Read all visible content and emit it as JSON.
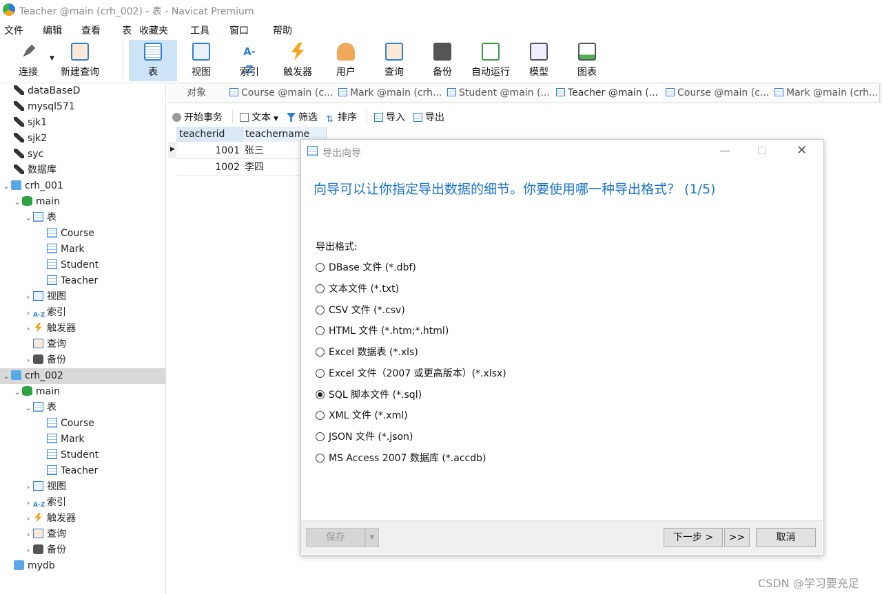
{
  "window": {
    "title": "Teacher @main (crh_002) - 表 - Navicat Premium"
  },
  "menu": [
    "文件",
    "编辑",
    "查看",
    "表",
    "收藏夹",
    "工具",
    "窗口",
    "帮助"
  ],
  "toolbar": {
    "connect": "连接",
    "new_query": "新建查询",
    "items": [
      "表",
      "视图",
      "索引",
      "触发器",
      "用户",
      "查询",
      "备份",
      "自动运行",
      "模型",
      "图表"
    ]
  },
  "tree": {
    "connections_top": [
      "dataBaseD",
      "mysql571",
      "sjk1",
      "sjk2",
      "syc",
      "数据库"
    ],
    "crh_001": {
      "name": "crh_001",
      "db": "main",
      "tables_label": "表",
      "tables": [
        "Course",
        "Mark",
        "Student",
        "Teacher"
      ],
      "others": [
        "视图",
        "索引",
        "触发器",
        "查询",
        "备份"
      ]
    },
    "crh_002": {
      "name": "crh_002",
      "db": "main",
      "tables_label": "表",
      "tables": [
        "Course",
        "Mark",
        "Student",
        "Teacher"
      ],
      "others": [
        "视图",
        "索引",
        "触发器",
        "查询",
        "备份"
      ]
    },
    "last": "mydb"
  },
  "tabs": [
    "对象",
    "Course @main (c...",
    "Mark @main (crh...",
    "Student @main (...",
    "Teacher @main (...",
    "Course @main (c...",
    "Mark @main (crh..."
  ],
  "subtoolbar": {
    "begin_tx": "开始事务",
    "text": "文本",
    "filter": "筛选",
    "sort": "排序",
    "import": "导入",
    "export": "导出"
  },
  "grid": {
    "columns": [
      "teacherid",
      "teachername"
    ],
    "rows": [
      [
        "1001",
        "张三"
      ],
      [
        "1002",
        "李四"
      ]
    ]
  },
  "dialog": {
    "title": "导出向导",
    "heading": "向导可以让你指定导出数据的细节。你要使用哪一种导出格式？ (1/5)",
    "format_label": "导出格式:",
    "formats": [
      "DBase 文件 (*.dbf)",
      "文本文件 (*.txt)",
      "CSV 文件 (*.csv)",
      "HTML 文件 (*.htm;*.html)",
      "Excel 数据表 (*.xls)",
      "Excel 文件（2007 或更高版本）(*.xlsx)",
      "SQL 脚本文件 (*.sql)",
      "XML 文件 (*.xml)",
      "JSON 文件 (*.json)",
      "MS Access 2007 数据库 (*.accdb)"
    ],
    "selected_index": 6,
    "save": "保存",
    "next": "下一步 >",
    "skip": ">>",
    "cancel": "取消"
  },
  "watermark": "CSDN @学习要充足",
  "colors": {
    "accent_blue": "#1a73c7",
    "selected_tool": "#cde4f7",
    "selected_tree": "#d9d9d9"
  }
}
